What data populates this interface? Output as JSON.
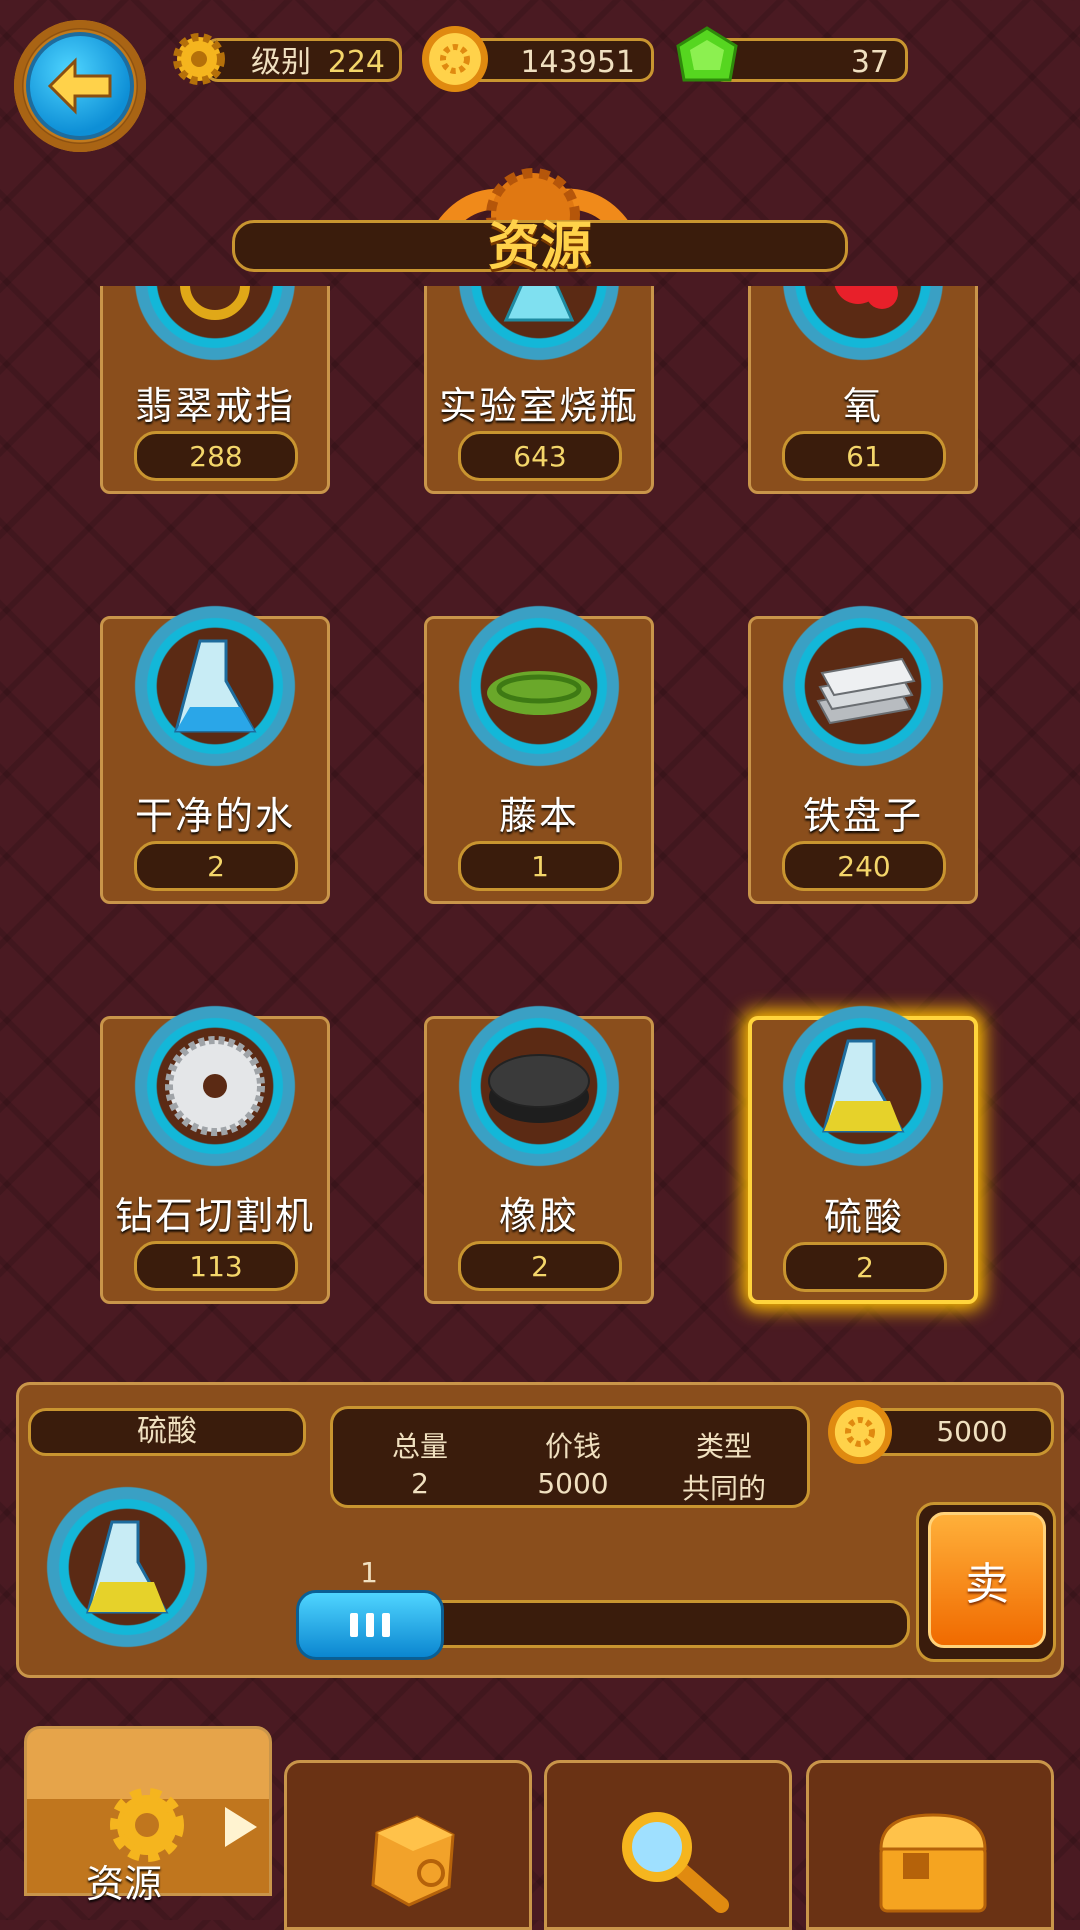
{
  "hud": {
    "level_label": "级别",
    "level_value": "224",
    "coins": "143951",
    "gems": "37"
  },
  "title": "资源",
  "cards": [
    {
      "name": "翡翠戒指",
      "count": "288",
      "icon": "emerald-ring-icon"
    },
    {
      "name": "实验室烧瓶",
      "count": "643",
      "icon": "lab-flask-icon"
    },
    {
      "name": "氧",
      "count": "61",
      "icon": "oxygen-icon"
    },
    {
      "name": "干净的水",
      "count": "2",
      "icon": "clean-water-flask-icon"
    },
    {
      "name": "藤本",
      "count": "1",
      "icon": "vine-icon"
    },
    {
      "name": "铁盘子",
      "count": "240",
      "icon": "iron-plates-icon"
    },
    {
      "name": "钻石切割机",
      "count": "113",
      "icon": "diamond-saw-icon"
    },
    {
      "name": "橡胶",
      "count": "2",
      "icon": "rubber-icon"
    },
    {
      "name": "硫酸",
      "count": "2",
      "icon": "sulfuric-acid-flask-icon"
    }
  ],
  "selected_index": 8,
  "info": {
    "name": "硫酸",
    "stats": [
      {
        "label": "总量",
        "value": "2"
      },
      {
        "label": "价钱",
        "value": "5000"
      },
      {
        "label": "类型",
        "value": "共同的"
      }
    ],
    "sale_price": "5000",
    "quantity": "1",
    "sell_label": "卖"
  },
  "tabs": [
    {
      "label": "资源",
      "icon": "gear-icon",
      "active": true
    },
    {
      "label": "",
      "icon": "dice-icon",
      "active": false
    },
    {
      "label": "",
      "icon": "magnifier-icon",
      "active": false
    },
    {
      "label": "",
      "icon": "chest-icon",
      "active": false
    }
  ],
  "colors": {
    "accent": "#ffd24a",
    "panel": "#8a4e1c",
    "dark": "#3a1c0c",
    "blue": "#0e8fd6",
    "orange": "#f06a00"
  }
}
